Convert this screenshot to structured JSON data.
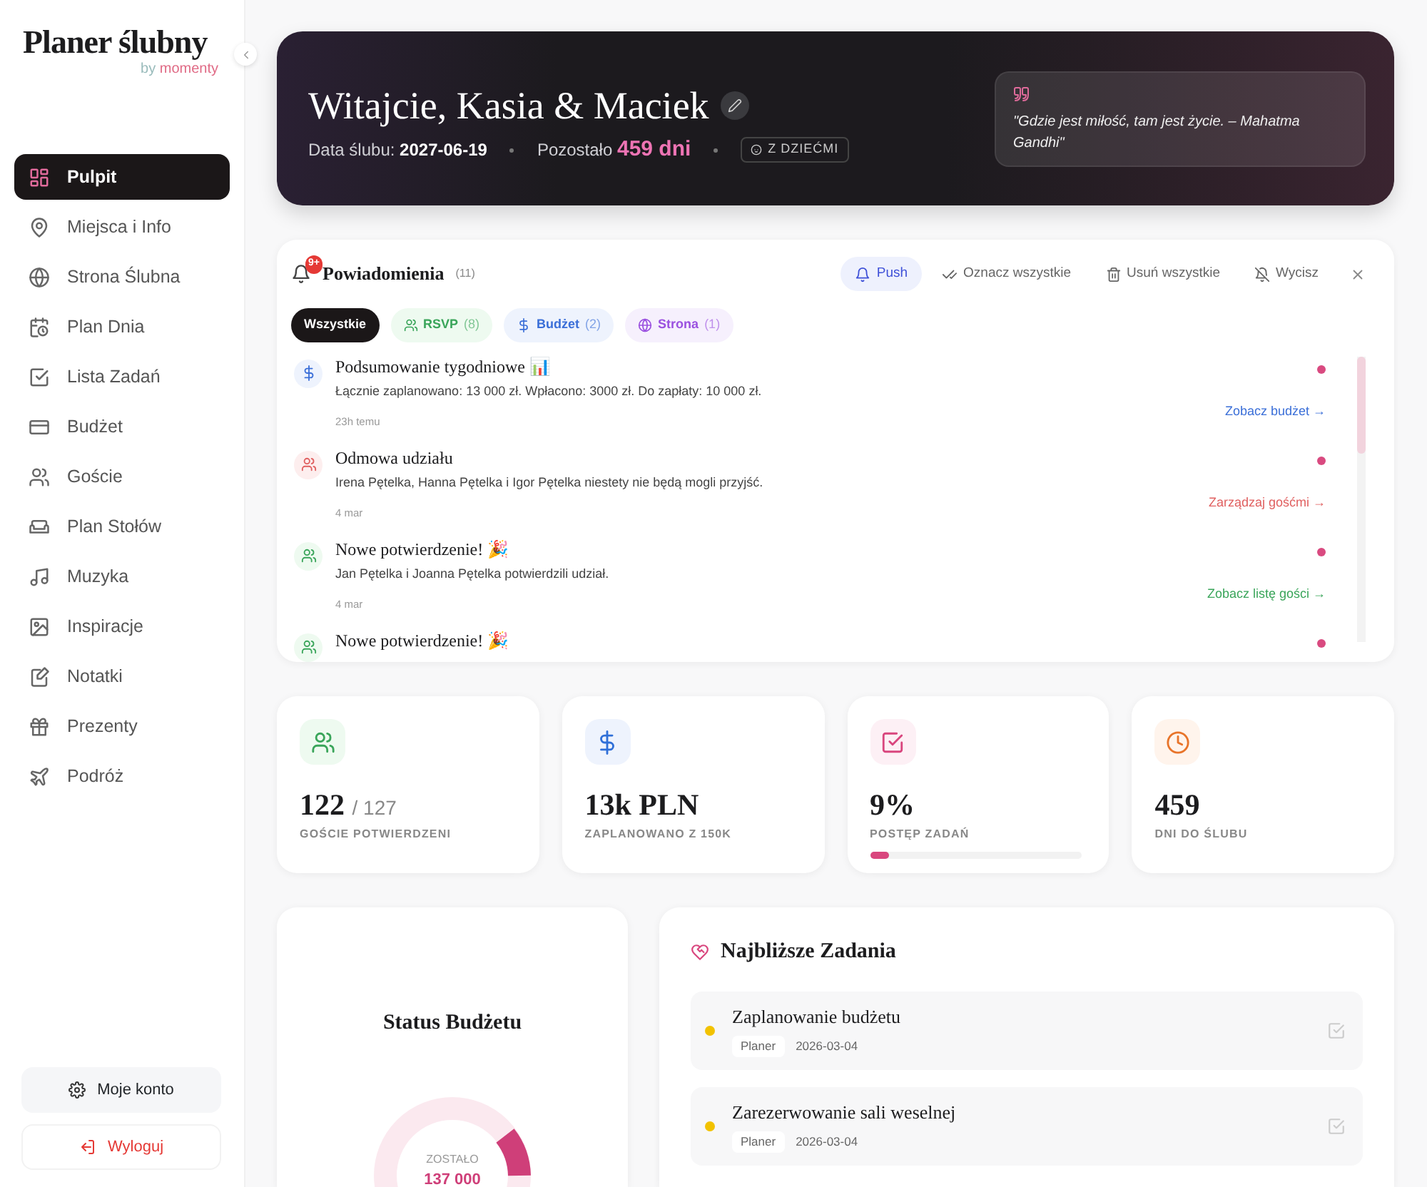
{
  "sidebar": {
    "logo": "Planer ślubny",
    "byline": "by",
    "brand": "momenty",
    "items": [
      {
        "label": "Pulpit",
        "selected": true
      },
      {
        "label": "Miejsca i Info",
        "selected": false
      },
      {
        "label": "Strona Ślubna",
        "selected": false
      },
      {
        "label": "Plan Dnia",
        "selected": false
      },
      {
        "label": "Lista Zadań",
        "selected": false
      },
      {
        "label": "Budżet",
        "selected": false
      },
      {
        "label": "Goście",
        "selected": false
      },
      {
        "label": "Plan Stołów",
        "selected": false
      },
      {
        "label": "Muzyka",
        "selected": false
      },
      {
        "label": "Inspiracje",
        "selected": false
      },
      {
        "label": "Notatki",
        "selected": false
      },
      {
        "label": "Prezenty",
        "selected": false
      },
      {
        "label": "Podróż",
        "selected": false
      }
    ],
    "account_button": "Moje konto",
    "logout_button": "Wyloguj"
  },
  "hero": {
    "title": "Witajcie, Kasia & Maciek",
    "date_label": "Data ślubu:",
    "date": "2027-06-19",
    "remaining_label": "Pozostało",
    "remaining": "459 dni",
    "badge": "Z DZIEĆMI",
    "quote": "\"Gdzie jest miłość, tam jest życie. – Mahatma Gandhi\""
  },
  "notifications": {
    "badge": "9+",
    "title": "Powiadomienia",
    "count": "(11)",
    "actions": [
      {
        "kind": "push",
        "label": "Push",
        "selected": true
      },
      {
        "kind": "mark",
        "label": "Oznacz wszystkie",
        "selected": false
      },
      {
        "kind": "delete",
        "label": "Usuń wszystkie",
        "selected": false
      },
      {
        "kind": "mute",
        "label": "Wycisz",
        "selected": false
      }
    ],
    "filters": [
      {
        "kind": "all",
        "label": "Wszystkie",
        "selected": true
      },
      {
        "kind": "rsvp",
        "label": "RSVP",
        "count": "(8)",
        "selected": false
      },
      {
        "kind": "budget",
        "label": "Budżet",
        "count": "(2)",
        "selected": false
      },
      {
        "kind": "site",
        "label": "Strona",
        "count": "(1)",
        "selected": false
      }
    ],
    "items": [
      {
        "kind": "budget",
        "title": "Podsumowanie tygodniowe 📊",
        "text": "Łącznie zaplanowano: 13 000 zł. Wpłacono: 3000 zł. Do zapłaty: 10 000 zł.",
        "time": "23h temu",
        "link": "Zobacz budżet →",
        "unread": true
      },
      {
        "kind": "decline",
        "title": "Odmowa udziału",
        "text": "Irena Pętelka, Hanna Pętelka i Igor Pętelka niestety nie będą mogli przyjść.",
        "time": "4 mar",
        "link": "Zarządzaj gośćmi →",
        "unread": true
      },
      {
        "kind": "rsvp",
        "title": "Nowe potwierdzenie! 🎉",
        "text": "Jan Pętelka i Joanna Pętelka potwierdzili udział.",
        "time": "4 mar",
        "link": "Zobacz listę gości →",
        "unread": true
      },
      {
        "kind": "rsvp",
        "title": "Nowe potwierdzenie! 🎉",
        "unread": true
      }
    ]
  },
  "stats": [
    {
      "kind": "guests",
      "value": "122",
      "suffix": "/ 127",
      "label": "GOŚCIE POTWIERDZENI"
    },
    {
      "kind": "budget",
      "value": "13k PLN",
      "label": "ZAPLANOWANO Z 150K"
    },
    {
      "kind": "tasks",
      "value": "9%",
      "label": "POSTĘP ZADAŃ",
      "level": 0.09
    },
    {
      "kind": "days",
      "value": "459",
      "label": "DNI DO ŚLUBU"
    }
  ],
  "budget_status": {
    "title": "Status Budżetu",
    "center_label": "ZOSTAŁO",
    "center_value": "137 000"
  },
  "tasks": {
    "title": "Najbliższe Zadania",
    "items": [
      {
        "title": "Zaplanowanie budżetu",
        "tag": "Planer",
        "date": "2026-03-04",
        "color": "#f2c200"
      },
      {
        "title": "Zarezerwowanie sali weselnej",
        "tag": "Planer",
        "date": "2026-03-04",
        "color": "#f2c200"
      }
    ]
  }
}
